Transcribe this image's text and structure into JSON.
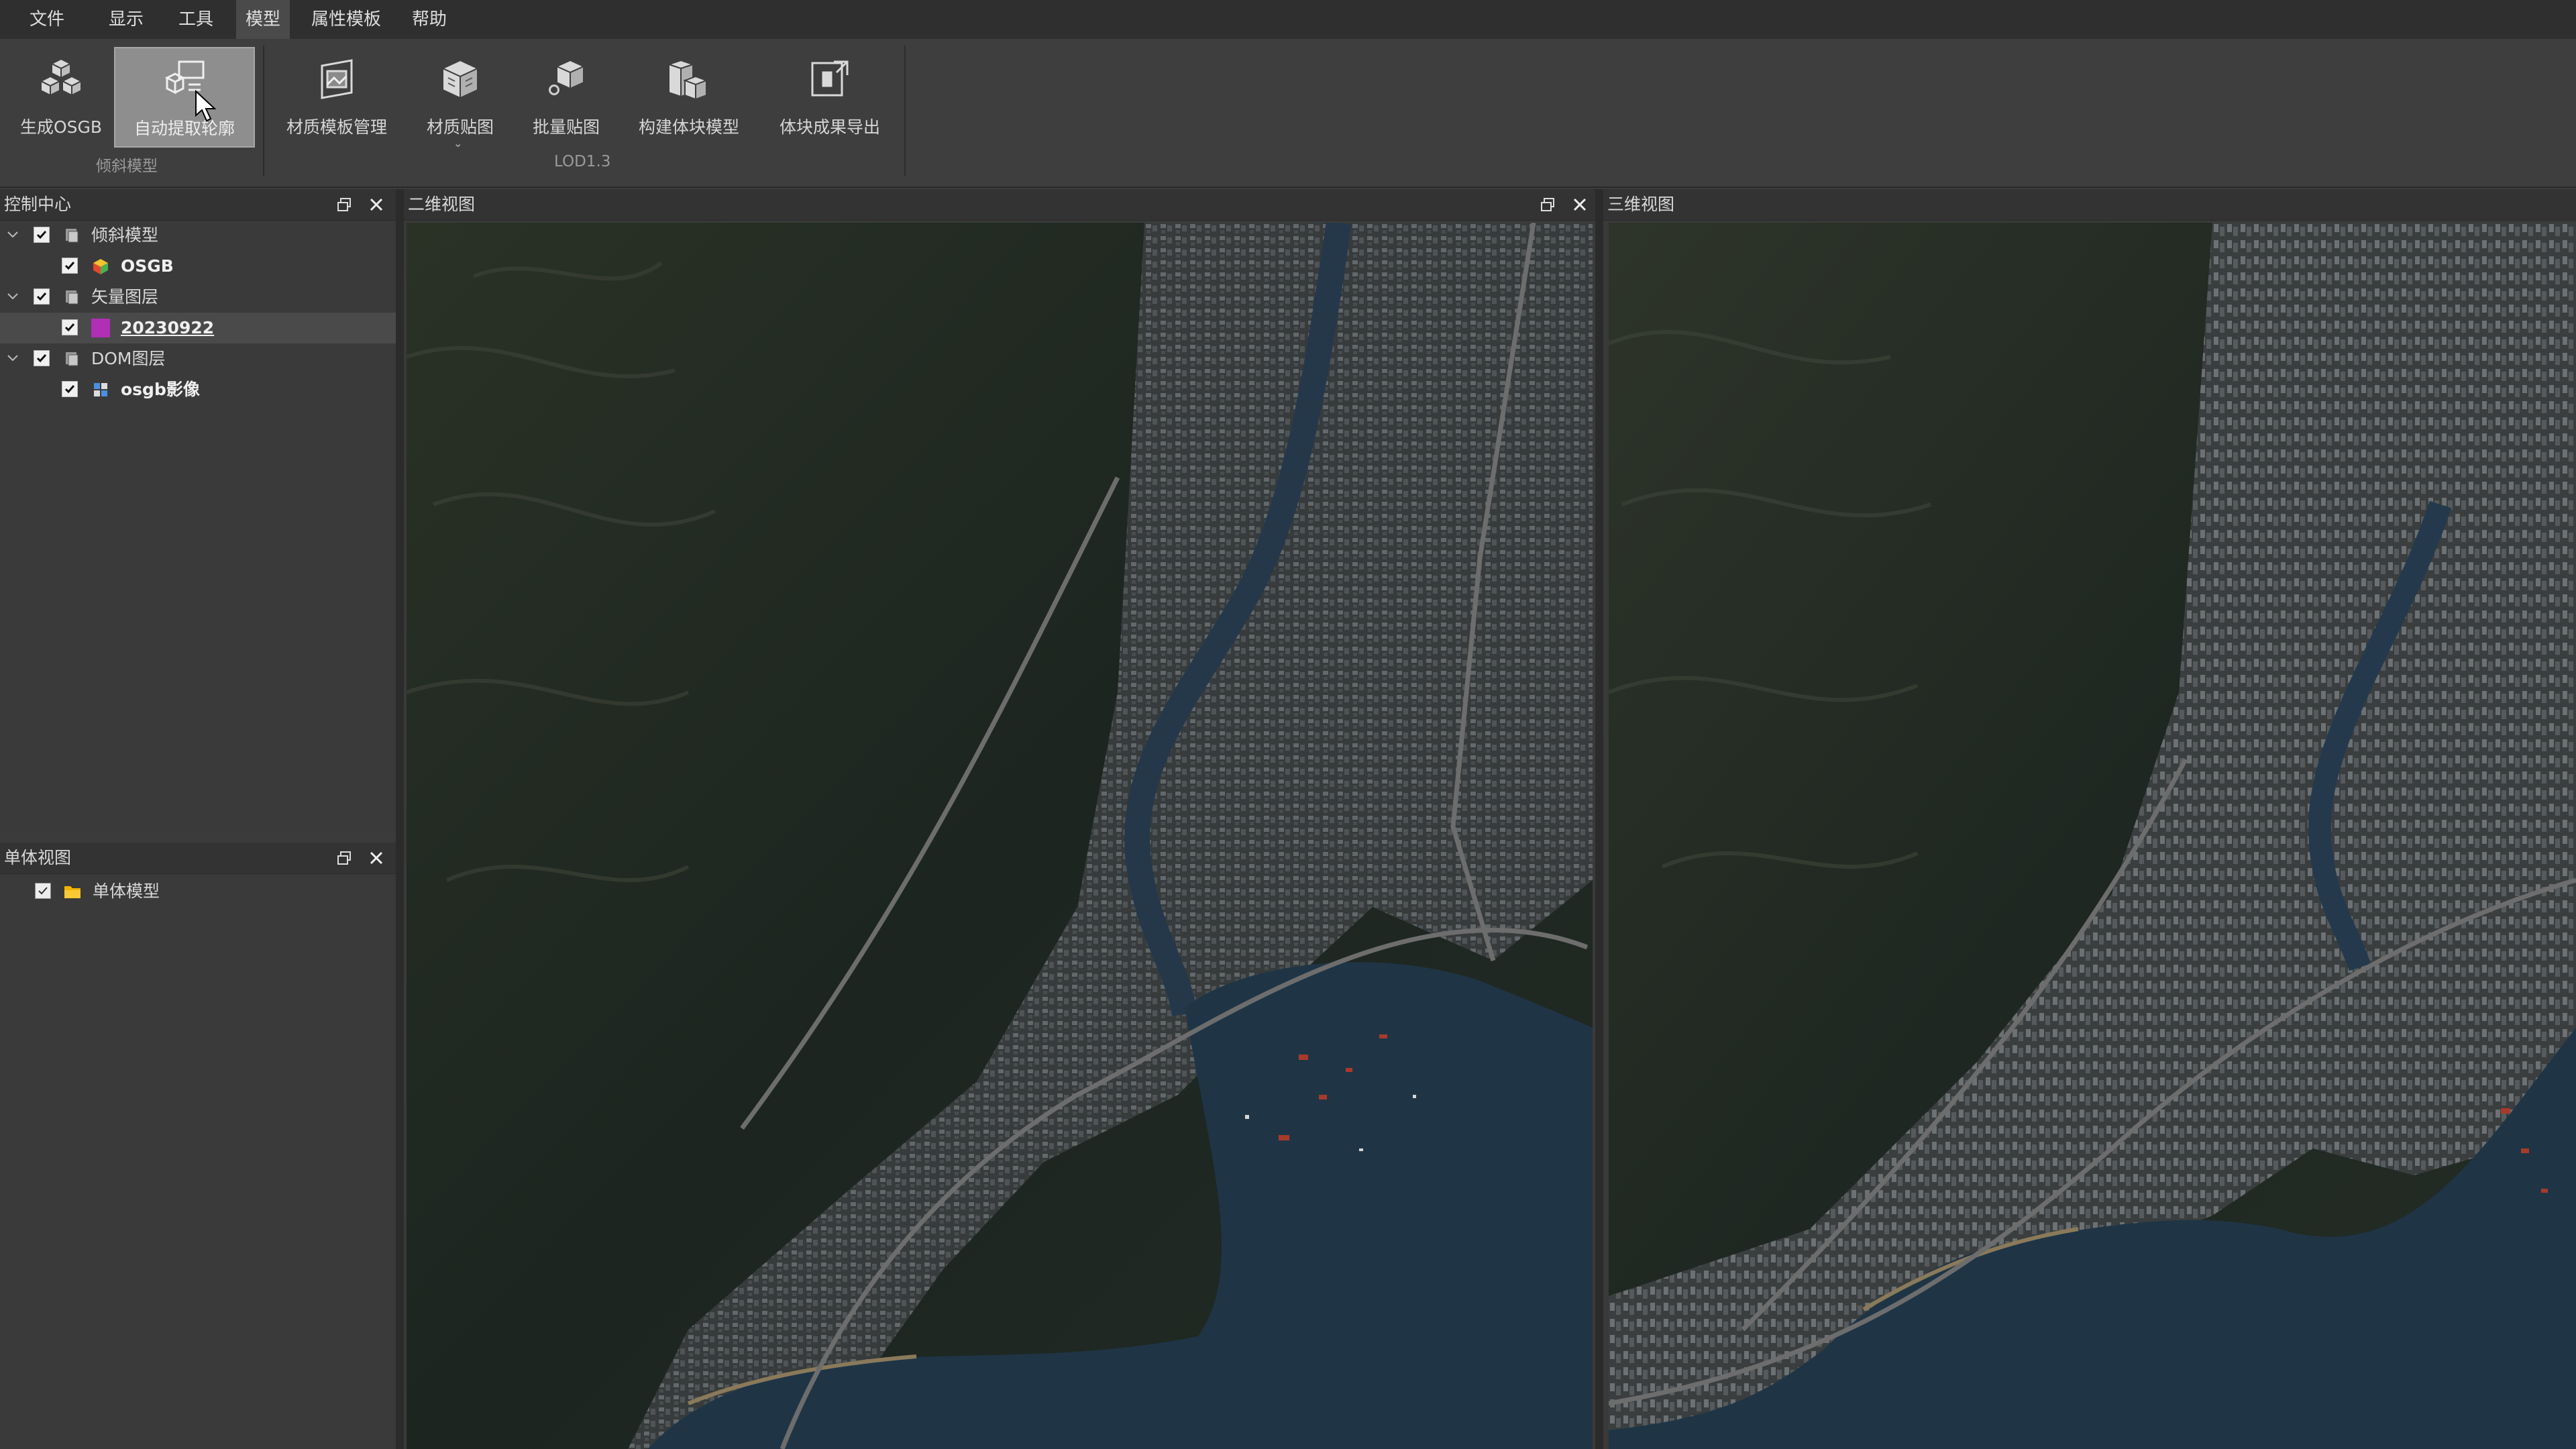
{
  "menu": {
    "items": [
      "文件",
      "显示",
      "工具",
      "模型",
      "属性模板",
      "帮助"
    ],
    "active": "模型"
  },
  "ribbon": {
    "buttons": [
      {
        "label": "生成OSGB",
        "icon": "stacked-cubes-icon"
      },
      {
        "label": "自动提取轮廓",
        "icon": "contour-extract-icon",
        "active": true
      },
      {
        "label": "材质模板管理",
        "icon": "material-template-icon"
      },
      {
        "label": "材质贴图",
        "icon": "texture-cube-icon",
        "has_dropdown": true
      },
      {
        "label": "批量贴图",
        "icon": "batch-texture-icon"
      },
      {
        "label": "构建体块模型",
        "icon": "block-model-icon"
      },
      {
        "label": "体块成果导出",
        "icon": "export-icon"
      }
    ],
    "groups": [
      "倾斜模型",
      "LOD1.3"
    ]
  },
  "control_panel": {
    "title": "控制中心",
    "tree": [
      {
        "label": "倾斜模型",
        "level": 0,
        "checked": true,
        "expanded": true,
        "icon": "layer-group-icon"
      },
      {
        "label": "OSGB",
        "level": 1,
        "checked": true,
        "icon": "osgb-cube-icon"
      },
      {
        "label": "矢量图层",
        "level": 0,
        "checked": true,
        "expanded": true,
        "icon": "layer-group-icon"
      },
      {
        "label": "20230922",
        "level": 1,
        "checked": true,
        "icon": "vector-swatch-icon",
        "selected": true
      },
      {
        "label": "DOM图层",
        "level": 0,
        "checked": true,
        "expanded": true,
        "icon": "layer-group-icon"
      },
      {
        "label": "osgb影像",
        "level": 1,
        "checked": true,
        "icon": "image-layer-icon"
      }
    ]
  },
  "single_panel": {
    "title": "单体视图",
    "tree": [
      {
        "label": "单体模型",
        "checked": true,
        "icon": "folder-icon"
      }
    ]
  },
  "view_2d": {
    "title": "二维视图"
  },
  "view_3d": {
    "title": "三维视图"
  },
  "colors": {
    "menubar": "#2f2f2f",
    "ribbon": "#3e3e3e",
    "panel": "#3a3a3a",
    "swatch": "#b02fb5",
    "folder": "#f0b400",
    "water": "#1f3546",
    "forest": "#1f2a22"
  }
}
